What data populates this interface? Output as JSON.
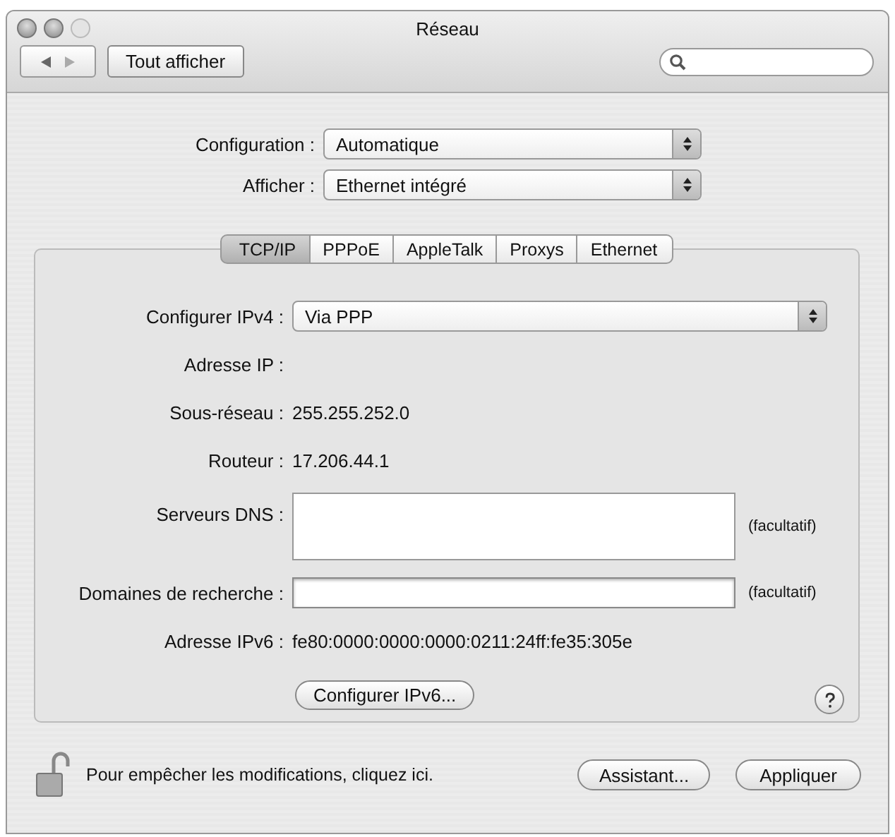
{
  "window": {
    "title": "Réseau"
  },
  "toolbar": {
    "show_all_button": "Tout afficher"
  },
  "top_fields": [
    {
      "label": "Configuration :",
      "value": "Automatique"
    },
    {
      "label": "Afficher :",
      "value": "Ethernet intégré"
    }
  ],
  "tabs": [
    {
      "label": "TCP/IP",
      "selected": true
    },
    {
      "label": "PPPoE",
      "selected": false
    },
    {
      "label": "AppleTalk",
      "selected": false
    },
    {
      "label": "Proxys",
      "selected": false
    },
    {
      "label": "Ethernet",
      "selected": false
    }
  ],
  "rows": [
    {
      "kind": "popup",
      "label": "Configurer IPv4 :",
      "value": "Via PPP"
    },
    {
      "kind": "static",
      "label": "Adresse IP :"
    },
    {
      "kind": "static",
      "label": "Sous-réseau :",
      "value": "255.255.252.0"
    },
    {
      "kind": "static",
      "label": "Routeur :",
      "value": "17.206.44.1"
    },
    {
      "kind": "textarea",
      "label": "Serveurs DNS :",
      "note": "(facultatif)"
    },
    {
      "kind": "field",
      "label": "Domaines de recherche :",
      "note": "(facultatif)"
    },
    {
      "kind": "static",
      "label": "Adresse IPv6 :",
      "value": "fe80:0000:0000:0000:0211:24ff:fe35:305e"
    }
  ],
  "configure_ipv6_button": "Configurer IPv6...",
  "footer": {
    "lock": {
      "locked": false
    },
    "lock_text": "Pour empêcher les modifications, cliquez ici.",
    "buttons": [
      "Assistant...",
      "Appliquer"
    ]
  }
}
